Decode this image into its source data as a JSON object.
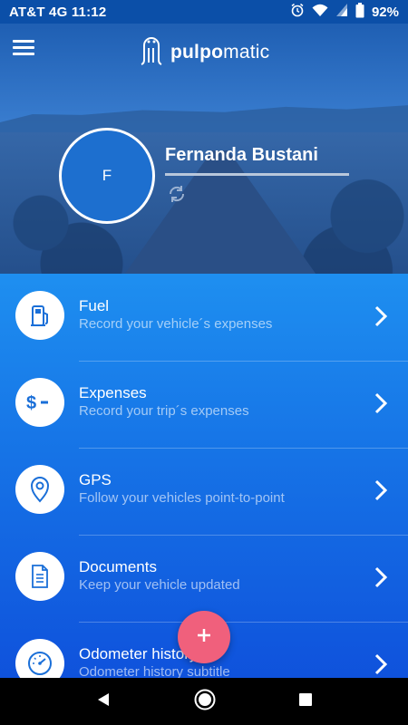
{
  "status_bar": {
    "carrier": "AT&T 4G",
    "time": "11:12",
    "battery": "92%",
    "icons": [
      "alarm-icon",
      "wifi-icon",
      "signal-icon",
      "battery-icon"
    ]
  },
  "header": {
    "menu_icon": "hamburger-menu-icon",
    "brand_bold": "pulpo",
    "brand_rest": "matic",
    "logo_icon": "octopus-logo-icon"
  },
  "profile": {
    "initial": "F",
    "name": "Fernanda Bustani",
    "sync_icon": "sync-icon"
  },
  "menu": {
    "items": [
      {
        "title": "Fuel",
        "subtitle": "Record your vehicle´s expenses",
        "icon": "fuel-pump-icon"
      },
      {
        "title": "Expenses",
        "subtitle": "Record your trip´s expenses",
        "icon": "dollar-icon"
      },
      {
        "title": "GPS",
        "subtitle": "Follow your vehicles point-to-point",
        "icon": "location-pin-icon"
      },
      {
        "title": "Documents",
        "subtitle": "Keep your vehicle updated",
        "icon": "document-icon"
      },
      {
        "title": "Odometer history",
        "subtitle": "Odometer history subtitle",
        "icon": "speedometer-icon"
      }
    ]
  },
  "fab": {
    "icon": "plus-icon"
  },
  "nav": {
    "back": "back-icon",
    "home": "home-icon",
    "recents": "recents-icon"
  },
  "colors": {
    "status_bg": "#0b4fa8",
    "list_top": "#1e8ff0",
    "list_bottom": "#0f52dc",
    "fab": "#f0607c",
    "icon_blue": "#1a6fd8"
  }
}
